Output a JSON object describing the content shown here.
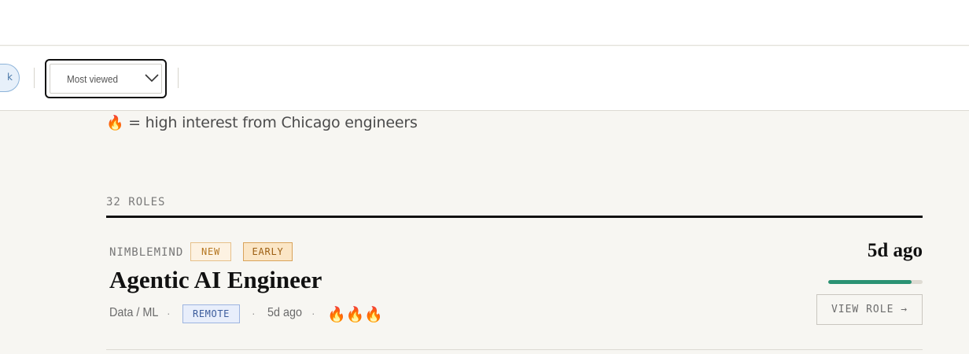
{
  "filters": {
    "partial_pill_text": "k",
    "sort": {
      "selected": "Most viewed"
    }
  },
  "legend": {
    "icon": "🔥",
    "text": "= high interest from Chicago engineers"
  },
  "results": {
    "count_label": "32 ROLES"
  },
  "jobs": [
    {
      "company": "NIMBLEMIND",
      "tags": [
        "NEW",
        "EARLY"
      ],
      "title": "Agentic AI Engineer",
      "category": "Data / ML",
      "work_type": "REMOTE",
      "posted_relative": "5d ago",
      "interest_flames": "🔥🔥🔥",
      "posted_headline": "5d ago",
      "freshness_fraction": 0.88,
      "cta": "VIEW ROLE →"
    }
  ],
  "colors": {
    "accent_green": "#2a9273",
    "tag_new_bg": "#fdf2e2",
    "tag_early_bg": "#fbe6c6",
    "tag_remote_bg": "#e8eefb"
  }
}
